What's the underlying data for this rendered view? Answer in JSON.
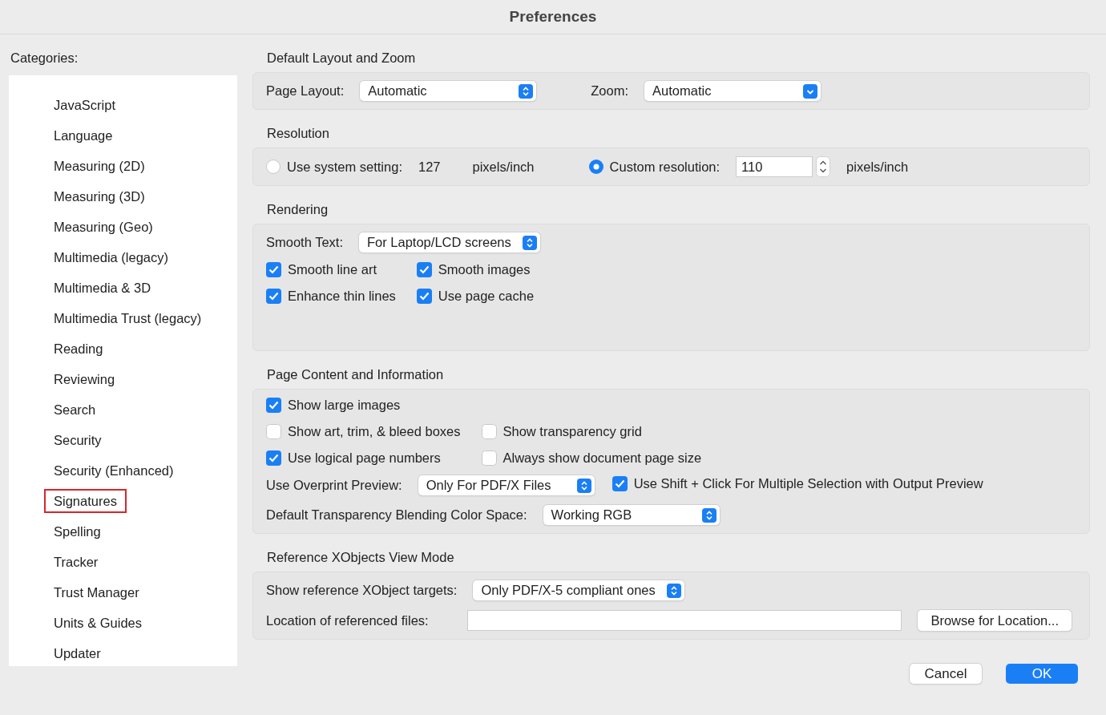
{
  "window": {
    "title": "Preferences"
  },
  "sidebar": {
    "label": "Categories:",
    "items": [
      {
        "label": "JavaScript",
        "highlighted": false
      },
      {
        "label": "Language",
        "highlighted": false
      },
      {
        "label": "Measuring (2D)",
        "highlighted": false
      },
      {
        "label": "Measuring (3D)",
        "highlighted": false
      },
      {
        "label": "Measuring (Geo)",
        "highlighted": false
      },
      {
        "label": "Multimedia (legacy)",
        "highlighted": false
      },
      {
        "label": "Multimedia & 3D",
        "highlighted": false
      },
      {
        "label": "Multimedia Trust (legacy)",
        "highlighted": false
      },
      {
        "label": "Reading",
        "highlighted": false
      },
      {
        "label": "Reviewing",
        "highlighted": false
      },
      {
        "label": "Search",
        "highlighted": false
      },
      {
        "label": "Security",
        "highlighted": false
      },
      {
        "label": "Security (Enhanced)",
        "highlighted": false
      },
      {
        "label": "Signatures",
        "highlighted": true
      },
      {
        "label": "Spelling",
        "highlighted": false
      },
      {
        "label": "Tracker",
        "highlighted": false
      },
      {
        "label": "Trust Manager",
        "highlighted": false
      },
      {
        "label": "Units & Guides",
        "highlighted": false
      },
      {
        "label": "Updater",
        "highlighted": false
      }
    ]
  },
  "sections": [
    {
      "title": "Default Layout and Zoom",
      "rows": [
        {
          "kind": "controls",
          "items": [
            {
              "kind": "label",
              "text": "Page Layout:"
            },
            {
              "kind": "popup",
              "value": "Automatic"
            },
            {
              "kind": "label",
              "text": "Zoom:"
            },
            {
              "kind": "pulldown",
              "value": "Automatic"
            }
          ]
        }
      ]
    },
    {
      "title": "Resolution",
      "rows": [
        {
          "kind": "controls",
          "items": [
            {
              "kind": "radio",
              "label": "Use system setting:",
              "selected": false
            },
            {
              "kind": "value",
              "text": "127"
            },
            {
              "kind": "value",
              "text": "pixels/inch"
            },
            {
              "kind": "radio",
              "label": "Custom resolution:",
              "selected": true
            },
            {
              "kind": "stepper",
              "value": "110"
            },
            {
              "kind": "value",
              "text": "pixels/inch"
            }
          ]
        }
      ]
    },
    {
      "title": "Rendering",
      "rows": [
        {
          "kind": "controls",
          "items": [
            {
              "kind": "label",
              "text": "Smooth Text:"
            },
            {
              "kind": "popup",
              "value": "For Laptop/LCD screens"
            }
          ]
        },
        {
          "kind": "checkgrid",
          "rows": [
            [
              {
                "label": "Smooth line art",
                "checked": true
              },
              {
                "label": "Smooth images",
                "checked": true
              }
            ],
            [
              {
                "label": "Enhance thin lines",
                "checked": true
              },
              {
                "label": "Use page cache",
                "checked": true
              }
            ]
          ]
        }
      ]
    },
    {
      "title": "Page Content and Information",
      "rows": [
        {
          "kind": "checkgrid",
          "rows": [
            [
              {
                "label": "Show large images",
                "checked": true
              }
            ],
            [
              {
                "label": "Show art, trim, & bleed boxes",
                "checked": false
              },
              {
                "label": "Show transparency grid",
                "checked": false
              }
            ],
            [
              {
                "label": "Use logical page numbers",
                "checked": true
              },
              {
                "label": "Always show document page size",
                "checked": false
              }
            ]
          ]
        },
        {
          "kind": "controls",
          "items": [
            {
              "kind": "label",
              "text": "Use Overprint Preview:"
            },
            {
              "kind": "popup",
              "value": "Only For PDF/X Files"
            },
            {
              "kind": "checkbox",
              "label": "Use Shift + Click For Multiple Selection with Output Preview",
              "checked": true
            }
          ]
        },
        {
          "kind": "controls",
          "items": [
            {
              "kind": "label",
              "text": "Default Transparency Blending Color Space:"
            },
            {
              "kind": "popup",
              "value": "Working RGB"
            }
          ]
        }
      ]
    },
    {
      "title": "Reference XObjects View Mode",
      "rows": [
        {
          "kind": "controls",
          "items": [
            {
              "kind": "label",
              "text": "Show reference XObject targets:"
            },
            {
              "kind": "popup",
              "value": "Only PDF/X-5 compliant ones"
            }
          ]
        },
        {
          "kind": "controls",
          "items": [
            {
              "kind": "label",
              "text": "Location of referenced files:"
            },
            {
              "kind": "text_input"
            },
            {
              "kind": "button",
              "label": "Browse for Location..."
            }
          ]
        }
      ]
    }
  ],
  "buttons": [
    {
      "label": "Cancel",
      "default": false
    },
    {
      "label": "OK",
      "default": true
    }
  ]
}
